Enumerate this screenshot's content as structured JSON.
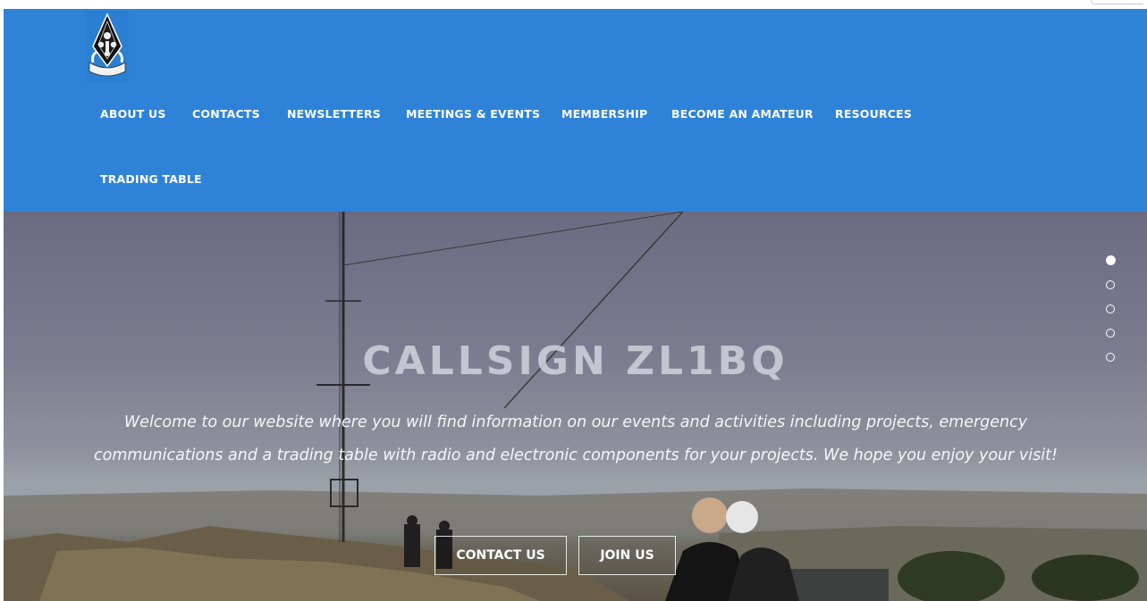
{
  "site": {
    "logo_name": "ZL1BQ club emblem"
  },
  "nav": {
    "items": [
      {
        "label": "ABOUT US"
      },
      {
        "label": "CONTACTS"
      },
      {
        "label": "NEWSLETTERS"
      },
      {
        "label": "MEETINGS & EVENTS"
      },
      {
        "label": "MEMBERSHIP"
      },
      {
        "label": "BECOME AN AMATEUR"
      },
      {
        "label": "RESOURCES"
      },
      {
        "label": "TRADING TABLE"
      }
    ]
  },
  "hero": {
    "title": "CALLSIGN ZL1BQ",
    "text": "Welcome to our website where you will find information on our events and activities including projects, emergency communications and a trading table with radio and electronic components for your projects. We hope you enjoy your visit!",
    "buttons": {
      "contact_label": "CONTACT US",
      "join_label": "JOIN US"
    },
    "slider": {
      "total": 5,
      "active_index": 0
    }
  },
  "colors": {
    "header_bg": "#2e83d9",
    "nav_text": "#ffffff"
  }
}
